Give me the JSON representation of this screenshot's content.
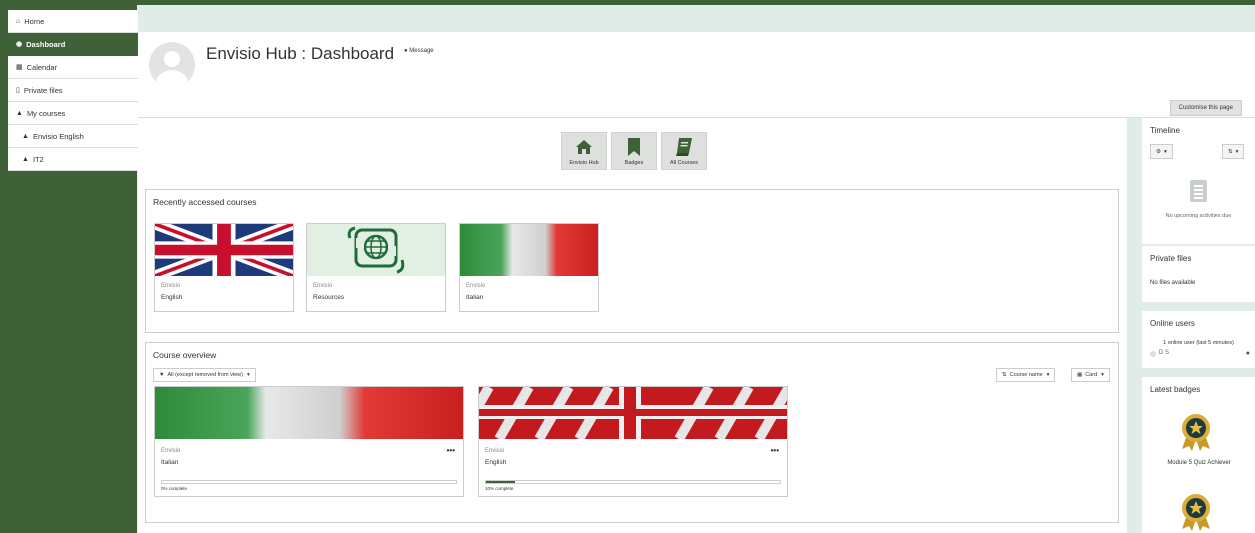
{
  "nav": {
    "home": "Home",
    "dashboard": "Dashboard",
    "calendar": "Calendar",
    "private_files": "Private files",
    "my_courses": "My courses",
    "envisio_english": "Envisio English",
    "it2": "IT2"
  },
  "header": {
    "title": "Envisio Hub : Dashboard",
    "message_label": "Message",
    "customise_label": "Customise this page"
  },
  "quick_links": [
    {
      "label": "Envisio Hub",
      "icon": "home-icon"
    },
    {
      "label": "Badges",
      "icon": "bookmark-icon"
    },
    {
      "label": "All Courses",
      "icon": "book-icon"
    }
  ],
  "recent": {
    "title": "Recently accessed courses",
    "courses": [
      {
        "category": "Envisio",
        "name": "English",
        "image": "uk-flag"
      },
      {
        "category": "Envisio",
        "name": "Resources",
        "image": "globe-resources"
      },
      {
        "category": "Envisio",
        "name": "Italian",
        "image": "italy-flag"
      }
    ]
  },
  "overview": {
    "title": "Course overview",
    "filter_label": "All (except removed from view)",
    "sort_label": "Course name",
    "view_label": "Card",
    "courses": [
      {
        "category": "Envisio",
        "name": "Italian",
        "progress": 0,
        "progress_label": "0% complete",
        "image": "italy-flag"
      },
      {
        "category": "Envisio",
        "name": "English",
        "progress": 10,
        "progress_label": "10% complete",
        "image": "england-flag"
      }
    ]
  },
  "timeline": {
    "title": "Timeline",
    "empty_text": "No upcoming activities due"
  },
  "private_files": {
    "title": "Private files",
    "empty_text": "No files available"
  },
  "online_users": {
    "title": "Online users",
    "summary": "1 online user (last 5 minutes)",
    "user": "D S"
  },
  "latest_badges": {
    "title": "Latest badges",
    "badge_name": "Module 5 Quiz Achiever"
  },
  "colors": {
    "brand": "#3e6138",
    "background": "#dfece7",
    "badge_gold": "#d4a72c"
  }
}
